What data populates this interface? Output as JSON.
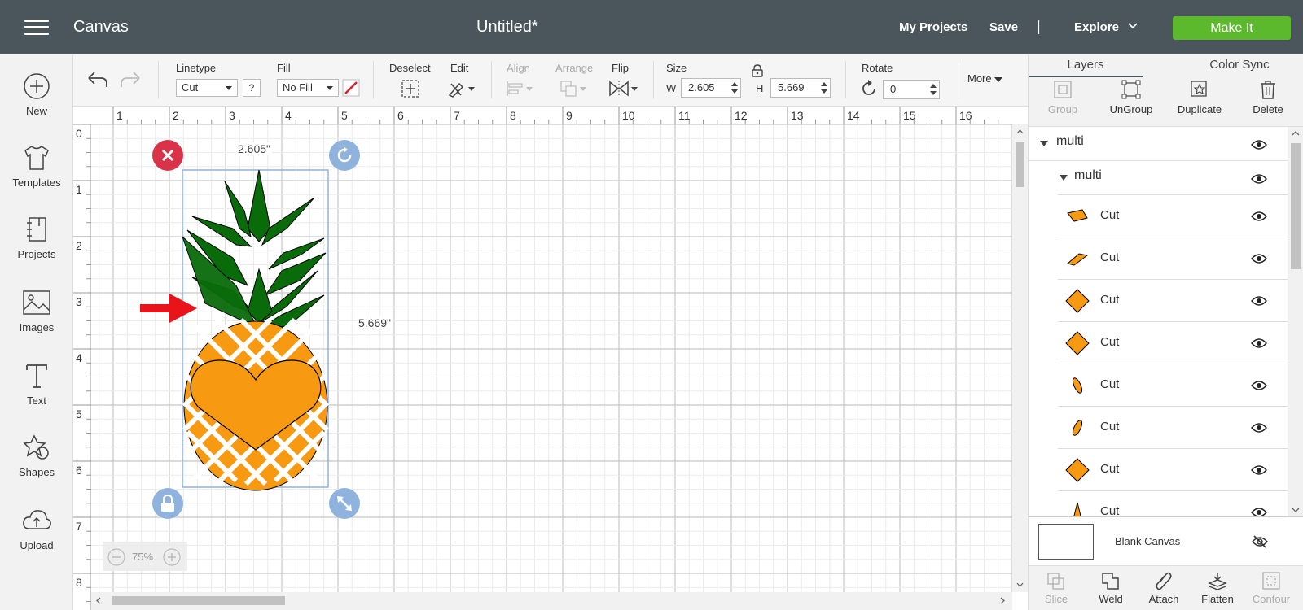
{
  "topbar": {
    "app_title": "Canvas",
    "doc_title": "Untitled*",
    "my_projects": "My Projects",
    "save": "Save",
    "separator": "|",
    "explore": "Explore",
    "make_it": "Make It"
  },
  "sidebar": {
    "items": [
      {
        "label": "New",
        "icon": "plus-circle-icon"
      },
      {
        "label": "Templates",
        "icon": "tshirt-icon"
      },
      {
        "label": "Projects",
        "icon": "notebook-icon"
      },
      {
        "label": "Images",
        "icon": "image-icon"
      },
      {
        "label": "Text",
        "icon": "text-icon"
      },
      {
        "label": "Shapes",
        "icon": "shapes-icon"
      },
      {
        "label": "Upload",
        "icon": "cloud-upload-icon"
      }
    ]
  },
  "toolbar": {
    "linetype_label": "Linetype",
    "linetype_value": "Cut",
    "help": "?",
    "fill_label": "Fill",
    "fill_value": "No Fill",
    "deselect_label": "Deselect",
    "edit_label": "Edit",
    "align_label": "Align",
    "arrange_label": "Arrange",
    "flip_label": "Flip",
    "size_label": "Size",
    "w_label": "W",
    "w_value": "2.605",
    "h_label": "H",
    "h_value": "5.669",
    "rotate_label": "Rotate",
    "rotate_value": "0",
    "more_label": "More"
  },
  "canvas": {
    "ruler_top": [
      "1",
      "2",
      "3",
      "4",
      "5",
      "6",
      "7",
      "8",
      "9",
      "10",
      "11",
      "12",
      "13",
      "14",
      "15",
      "16"
    ],
    "ruler_left": [
      "0",
      "1",
      "2",
      "3",
      "4",
      "5",
      "6",
      "7",
      "8"
    ],
    "width_label": "2.605\"",
    "height_label": "5.669\"",
    "zoom": "75%",
    "zoom_minus": "−",
    "zoom_plus": "+"
  },
  "panel": {
    "tabs": [
      "Layers",
      "Color Sync"
    ],
    "actions": [
      "Group",
      "UnGroup",
      "Duplicate",
      "Delete"
    ],
    "group_name": "multi",
    "subgroup_name": "multi",
    "layers": [
      "Cut",
      "Cut",
      "Cut",
      "Cut",
      "Cut",
      "Cut",
      "Cut",
      "Cut"
    ],
    "blank_canvas": "Blank Canvas",
    "bottom_actions": [
      "Slice",
      "Weld",
      "Attach",
      "Flatten",
      "Contour"
    ]
  },
  "colors": {
    "topbar": "#4b555c",
    "make_it": "#5cb82c",
    "pineapple_leaf": "#0a6b0a",
    "pineapple_body": "#f79a12",
    "handle_blue": "#8fb3dc",
    "handle_red": "#d9334a",
    "arrow_red": "#e8141a"
  }
}
